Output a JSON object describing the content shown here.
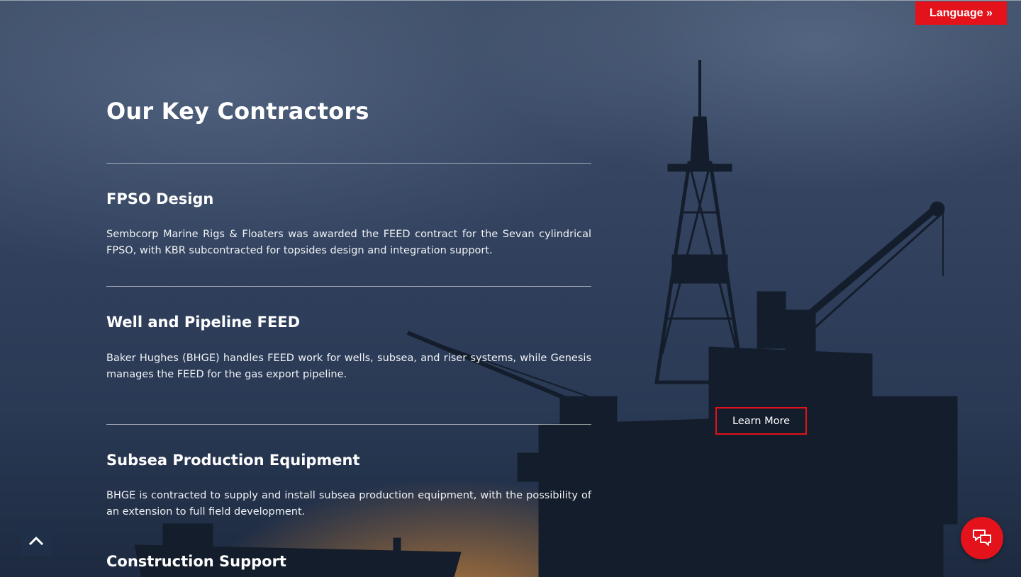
{
  "header": {
    "language_button": "Language »"
  },
  "main": {
    "title": "Our Key Contractors",
    "sections": [
      {
        "title": "FPSO Design",
        "text": "Sembcorp Marine Rigs & Floaters was awarded the FEED contract for the Sevan cylindrical FPSO, with KBR subcontracted for topsides design and integration support."
      },
      {
        "title": "Well and Pipeline FEED",
        "text": "Baker Hughes (BHGE) handles FEED work for wells, subsea, and riser systems, while Genesis manages the FEED for the gas export pipeline."
      },
      {
        "title": "Subsea Production Equipment",
        "text": "BHGE is contracted to supply and install subsea production equipment, with the possibility of an extension to full field development."
      },
      {
        "title": "Construction Support",
        "text": ""
      }
    ],
    "learn_more_button": "Learn More"
  },
  "icons": {
    "scroll_top": "chevron-up-icon",
    "chat": "chat-bubbles-icon"
  },
  "colors": {
    "accent": "#e3121b",
    "background": "#2b3b55"
  }
}
